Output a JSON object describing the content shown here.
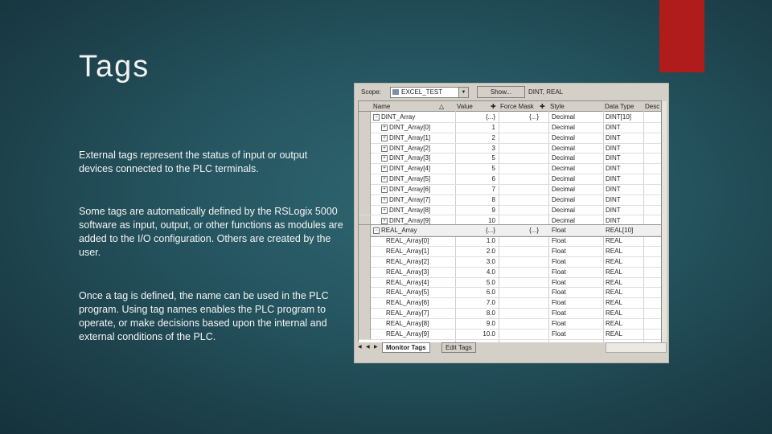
{
  "title": "Tags",
  "paragraphs": [
    "External tags represent the status of input or output devices connected to the PLC terminals.",
    "Some tags are automatically defined by the RSLogix 5000 software as input, output, or other functions as modules are added to the I/O configuration.  Others are created by the user.",
    "Once a tag is defined, the name can be used in the PLC program.  Using tag names enables the PLC program to operate, or make decisions based upon the internal and external conditions of the PLC."
  ],
  "accent_color": "#b01c1c",
  "tag_window": {
    "scope_label": "Scope:",
    "scope_value": "EXCEL_TEST",
    "show_button": "Show...",
    "filter_text": "DINT, REAL",
    "columns": {
      "name": "Name",
      "value": "Value",
      "force_mask": "Force Mask",
      "style": "Style",
      "data_type": "Data Type",
      "desc": "Desc"
    },
    "rows": [
      {
        "name": "DINT_Array",
        "value": "{...}",
        "force": "{...}",
        "style": "Decimal",
        "type": "DINT[10]",
        "level": 0,
        "exp": "−"
      },
      {
        "name": "DINT_Array[0]",
        "value": "1",
        "force": "",
        "style": "Decimal",
        "type": "DINT",
        "level": 1,
        "exp": "+"
      },
      {
        "name": "DINT_Array[1]",
        "value": "2",
        "force": "",
        "style": "Decimal",
        "type": "DINT",
        "level": 1,
        "exp": "+"
      },
      {
        "name": "DINT_Array[2]",
        "value": "3",
        "force": "",
        "style": "Decimal",
        "type": "DINT",
        "level": 1,
        "exp": "+"
      },
      {
        "name": "DINT_Array[3]",
        "value": "5",
        "force": "",
        "style": "Decimal",
        "type": "DINT",
        "level": 1,
        "exp": "+"
      },
      {
        "name": "DINT_Array[4]",
        "value": "5",
        "force": "",
        "style": "Decimal",
        "type": "DINT",
        "level": 1,
        "exp": "+"
      },
      {
        "name": "DINT_Array[5]",
        "value": "6",
        "force": "",
        "style": "Decimal",
        "type": "DINT",
        "level": 1,
        "exp": "+"
      },
      {
        "name": "DINT_Array[6]",
        "value": "7",
        "force": "",
        "style": "Decimal",
        "type": "DINT",
        "level": 1,
        "exp": "+"
      },
      {
        "name": "DINT_Array[7]",
        "value": "8",
        "force": "",
        "style": "Decimal",
        "type": "DINT",
        "level": 1,
        "exp": "+"
      },
      {
        "name": "DINT_Array[8]",
        "value": "9",
        "force": "",
        "style": "Decimal",
        "type": "DINT",
        "level": 1,
        "exp": "+"
      },
      {
        "name": "DINT_Array[9]",
        "value": "10",
        "force": "",
        "style": "Decimal",
        "type": "DINT",
        "level": 1,
        "exp": "+"
      },
      {
        "name": "REAL_Array",
        "value": "{...}",
        "force": "{...}",
        "style": "Float",
        "type": "REAL[10]",
        "level": 0,
        "exp": "−",
        "selected": true
      },
      {
        "name": "REAL_Array[0]",
        "value": "1.0",
        "force": "",
        "style": "Float",
        "type": "REAL",
        "level": 1,
        "exp": ""
      },
      {
        "name": "REAL_Array[1]",
        "value": "2.0",
        "force": "",
        "style": "Float",
        "type": "REAL",
        "level": 1,
        "exp": ""
      },
      {
        "name": "REAL_Array[2]",
        "value": "3.0",
        "force": "",
        "style": "Float",
        "type": "REAL",
        "level": 1,
        "exp": ""
      },
      {
        "name": "REAL_Array[3]",
        "value": "4.0",
        "force": "",
        "style": "Float",
        "type": "REAL",
        "level": 1,
        "exp": ""
      },
      {
        "name": "REAL_Array[4]",
        "value": "5.0",
        "force": "",
        "style": "Float",
        "type": "REAL",
        "level": 1,
        "exp": ""
      },
      {
        "name": "REAL_Array[5]",
        "value": "6.0",
        "force": "",
        "style": "Float",
        "type": "REAL",
        "level": 1,
        "exp": ""
      },
      {
        "name": "REAL_Array[6]",
        "value": "7.0",
        "force": "",
        "style": "Float",
        "type": "REAL",
        "level": 1,
        "exp": ""
      },
      {
        "name": "REAL_Array[7]",
        "value": "8.0",
        "force": "",
        "style": "Float",
        "type": "REAL",
        "level": 1,
        "exp": ""
      },
      {
        "name": "REAL_Array[8]",
        "value": "9.0",
        "force": "",
        "style": "Float",
        "type": "REAL",
        "level": 1,
        "exp": ""
      },
      {
        "name": "REAL_Array[9]",
        "value": "10.0",
        "force": "",
        "style": "Float",
        "type": "REAL",
        "level": 1,
        "exp": ""
      }
    ],
    "tabs": [
      "Monitor Tags",
      "Edit Tags"
    ],
    "active_tab": "Monitor Tags"
  }
}
